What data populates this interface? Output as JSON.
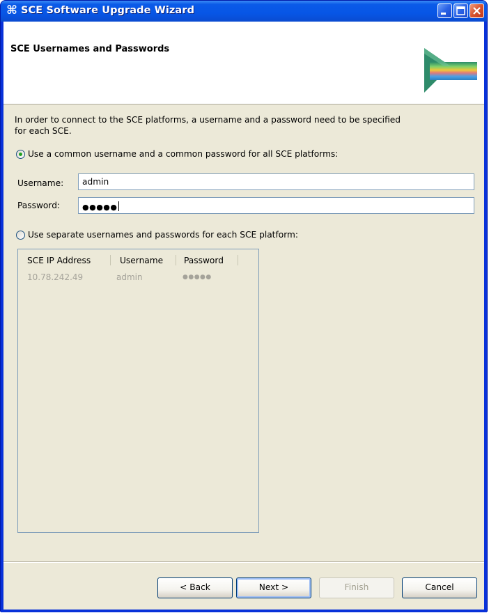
{
  "window": {
    "title": "SCE Software Upgrade Wizard",
    "icon": "cisco-wizard-icon"
  },
  "header": {
    "title": "SCE Usernames and Passwords"
  },
  "intro": {
    "line1": "In order to connect to the SCE platforms, a username and a password need to be specified",
    "line2": "for each SCE."
  },
  "common_option": {
    "label": "Use a common username and a common password for all SCE platforms:",
    "selected": true
  },
  "username": {
    "label": "Username:",
    "value": "admin"
  },
  "password": {
    "label": "Password:",
    "value": "●●●●●"
  },
  "separate_option": {
    "label": "Use separate usernames and passwords for each SCE platform:",
    "selected": false
  },
  "table": {
    "columns": [
      "SCE IP Address",
      "Username",
      "Password"
    ],
    "rows": [
      {
        "ip": "10.78.242.49",
        "username": "admin",
        "password": "●●●●●"
      }
    ]
  },
  "buttons": {
    "back": "< Back",
    "next": "Next >",
    "finish": "Finish",
    "cancel": "Cancel"
  },
  "colors": {
    "titlebar": "#0a5ae8",
    "dialog_bg": "#ece9d8",
    "radio_dot": "#21a121",
    "disabled_text": "#a5a39a"
  }
}
